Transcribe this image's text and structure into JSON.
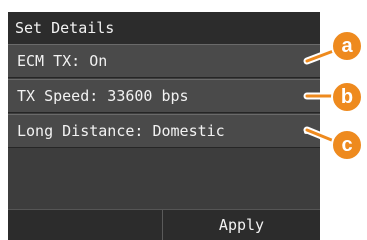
{
  "screen": {
    "title": "Set Details",
    "items": [
      {
        "label": "ECM TX: On",
        "callout": "a"
      },
      {
        "label": "TX Speed: 33600 bps",
        "callout": "b"
      },
      {
        "label": "Long Distance: Domestic",
        "callout": "c"
      }
    ],
    "apply_label": "Apply"
  },
  "colors": {
    "callout": "#ee8a1e",
    "panel": "#3d3d3d",
    "bar": "#2c2c2c"
  }
}
